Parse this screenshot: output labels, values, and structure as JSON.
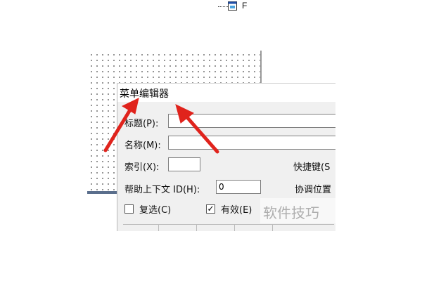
{
  "tree_item": {
    "label": "F",
    "icon": "form-icon"
  },
  "dialog": {
    "title": "菜单编辑器",
    "caption": {
      "label": "标题(P):",
      "value": ""
    },
    "name": {
      "label": "名称(M):",
      "value": ""
    },
    "index": {
      "label": "索引(X):",
      "value": ""
    },
    "shortcut": {
      "label": "快捷键(S"
    },
    "help_context": {
      "label": "帮助上下文 ID(H):",
      "value": "0"
    },
    "negotiate_position": {
      "label": "协调位置"
    },
    "checked": {
      "label": "复选(C)",
      "state": false
    },
    "enabled": {
      "label": "有效(E)",
      "state": true
    }
  },
  "watermark": {
    "text": "软件技巧"
  },
  "colors": {
    "arrow": "#e0231c",
    "dialog_bg": "#f0f0f0",
    "grid_dots": "#7a7a7a"
  }
}
